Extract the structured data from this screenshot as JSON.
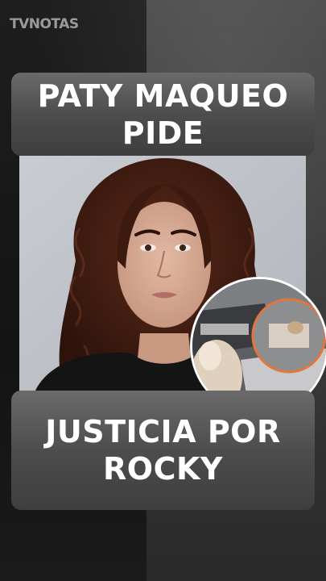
{
  "brand": {
    "logo_text": "TVNOTAS"
  },
  "headline": {
    "line_top": "PATY MAQUEO PIDE",
    "line_bottom": "JUSTICIA POR ROCKY"
  },
  "images": {
    "main_photo": "portrait-photo",
    "inset_photo": "inset-photo"
  }
}
